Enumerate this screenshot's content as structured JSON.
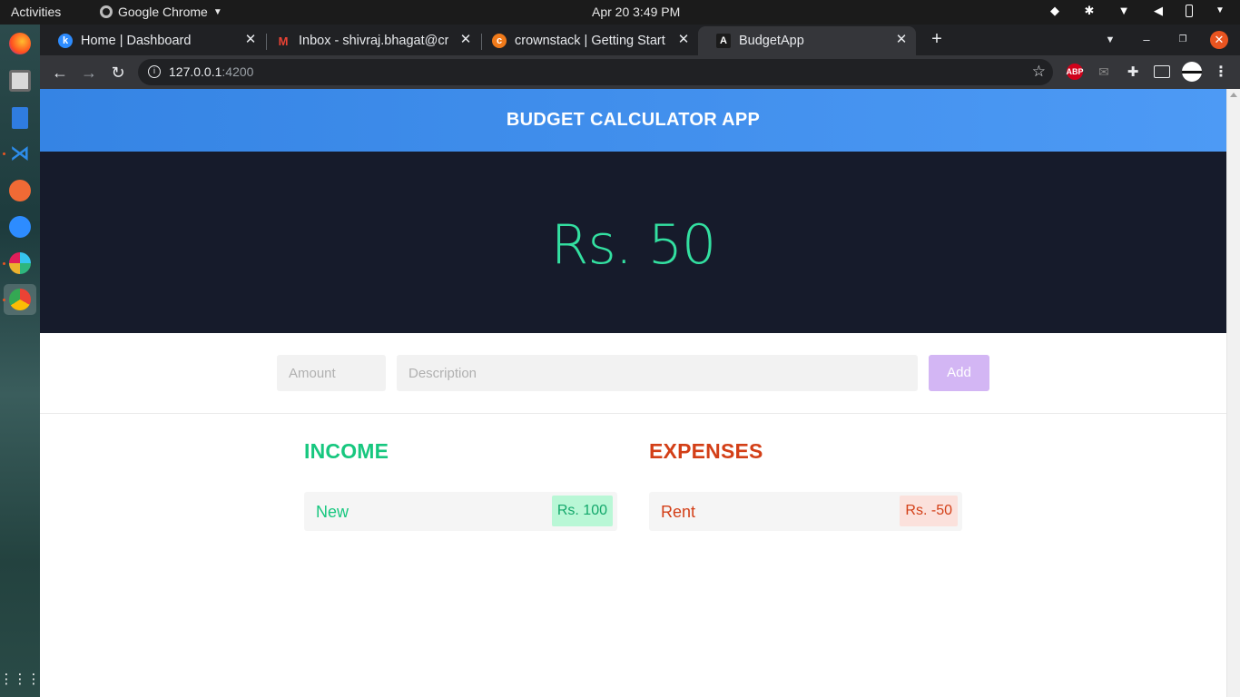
{
  "topbar": {
    "activities": "Activities",
    "app_name": "Google Chrome",
    "clock": "Apr 20   3:49 PM"
  },
  "tabs": [
    {
      "title": "Home | Dashboard",
      "favicon": "k"
    },
    {
      "title": "Inbox - shivraj.bhagat@cr",
      "favicon": "M"
    },
    {
      "title": "crownstack | Getting Start",
      "favicon": "c"
    },
    {
      "title": "BudgetApp",
      "favicon": "A"
    }
  ],
  "address_bar": {
    "host": "127.0.0.1",
    "port": ":4200"
  },
  "extensions": {
    "abp": "ABP"
  },
  "app": {
    "header": "BUDGET CALCULATOR APP",
    "balance": "Rs. 50",
    "amount_placeholder": "Amount",
    "description_placeholder": "Description",
    "add_label": "Add",
    "income": {
      "title": "INCOME",
      "items": [
        {
          "description": "New",
          "amount": "Rs. 100"
        }
      ]
    },
    "expenses": {
      "title": "EXPENSES",
      "items": [
        {
          "description": "Rent",
          "amount": "Rs. -50"
        }
      ]
    }
  },
  "colors": {
    "header_blue": "#3584e4",
    "panel_dark": "#161b2b",
    "balance_green": "#33e0a1",
    "income_green": "#17c77f",
    "expense_red": "#d33f17",
    "add_purple": "#d3b6f4"
  }
}
